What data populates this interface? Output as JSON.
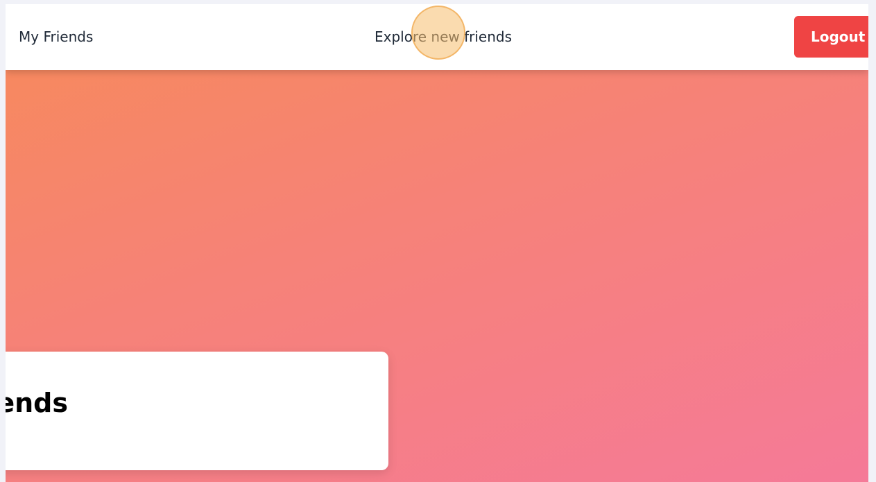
{
  "navbar": {
    "my_friends_label": "My Friends",
    "explore_label": "Explore new friends",
    "logout_label": "Logout"
  },
  "card": {
    "title": "ends"
  },
  "colors": {
    "accent_logout": "#ef4444",
    "gradient_start": "#f78a5a",
    "gradient_end": "#f57a98",
    "click_marker": "#f5be6e"
  }
}
